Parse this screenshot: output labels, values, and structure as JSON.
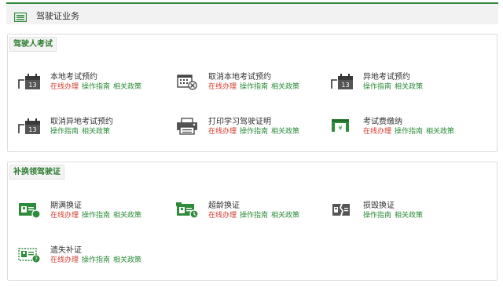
{
  "header": {
    "title": "驾驶证业务",
    "icon": "list-icon"
  },
  "colors": {
    "accent": "#2e8b3a",
    "online": "#d33a2c",
    "link": "#2e8b3a"
  },
  "sections": [
    {
      "title": "驾驶人考试",
      "items": [
        {
          "name": "本地考试预约",
          "icon": "calendar-icon",
          "links": [
            "在线办理",
            "操作指南",
            "相关政策"
          ]
        },
        {
          "name": "取消本地考试预约",
          "icon": "calendar-cancel-icon",
          "links": [
            "在线办理",
            "操作指南",
            "相关政策"
          ]
        },
        {
          "name": "异地考试预约",
          "icon": "calendar-icon",
          "links": [
            "操作指南",
            "相关政策"
          ]
        },
        {
          "name": "取消异地考试预约",
          "icon": "calendar-icon",
          "links": [
            "操作指南",
            "相关政策"
          ]
        },
        {
          "name": "打印学习驾驶证明",
          "icon": "printer-icon",
          "links": [
            "在线办理",
            "操作指南",
            "相关政策"
          ]
        },
        {
          "name": "考试费缴纳",
          "icon": "payment-icon",
          "links": [
            "在线办理",
            "操作指南",
            "相关政策"
          ]
        }
      ]
    },
    {
      "title": "补换领驾驶证",
      "items": [
        {
          "name": "期满换证",
          "icon": "id-card-icon",
          "links": [
            "在线办理",
            "操作指南",
            "相关政策"
          ]
        },
        {
          "name": "超龄换证",
          "icon": "id-card-age-icon",
          "links": [
            "在线办理",
            "操作指南",
            "相关政策"
          ]
        },
        {
          "name": "损毁换证",
          "icon": "id-card-damaged-icon",
          "links": [
            "操作指南",
            "相关政策"
          ]
        },
        {
          "name": "遗失补证",
          "icon": "id-card-lost-icon",
          "links": [
            "在线办理",
            "操作指南",
            "相关政策"
          ]
        }
      ]
    }
  ]
}
